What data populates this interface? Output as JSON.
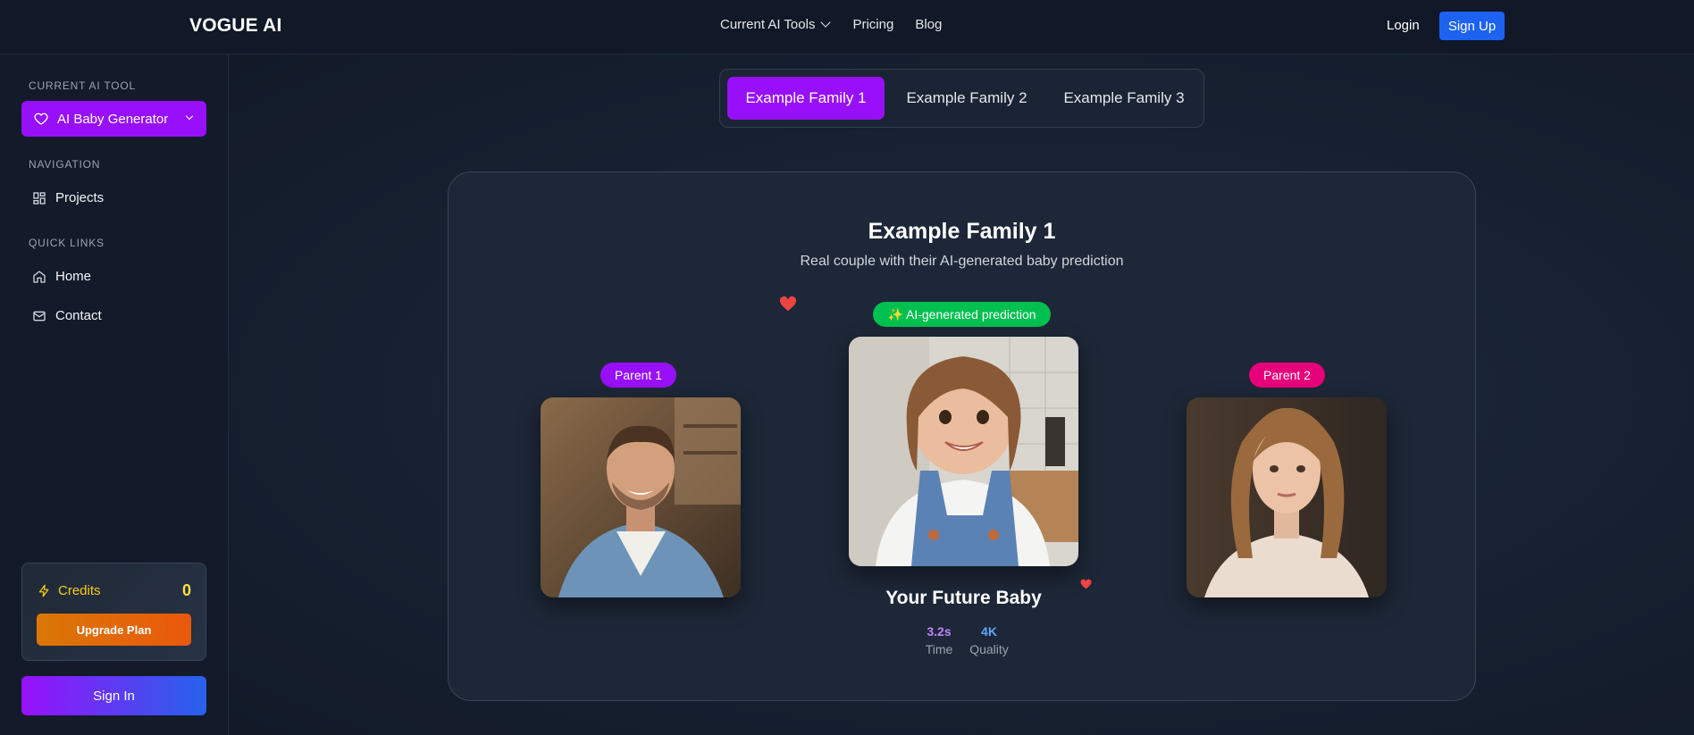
{
  "header": {
    "brand": "VOGUE AI",
    "nav": {
      "tools": "Current AI Tools",
      "pricing": "Pricing",
      "blog": "Blog"
    },
    "login": "Login",
    "signup": "Sign Up"
  },
  "sidebar": {
    "current_tool_label": "CURRENT AI TOOL",
    "current_tool": "AI Baby Generator",
    "navigation_label": "NAVIGATION",
    "projects": "Projects",
    "quick_links_label": "QUICK LINKS",
    "home": "Home",
    "contact": "Contact",
    "credits": {
      "label": "Credits",
      "value": "0",
      "upgrade": "Upgrade Plan"
    },
    "sign_in": "Sign In"
  },
  "tabs": [
    "Example Family 1",
    "Example Family 2",
    "Example Family 3"
  ],
  "active_tab": 0,
  "example": {
    "title": "Example Family 1",
    "subtitle": "Real couple with their AI-generated baby prediction",
    "parent1": "Parent 1",
    "parent2": "Parent 2",
    "ai_badge": "✨ AI-generated prediction",
    "baby_title": "Your Future Baby",
    "stats": [
      {
        "value": "3.2s",
        "label": "Time"
      },
      {
        "value": "4K",
        "label": "Quality"
      }
    ]
  },
  "colors": {
    "accent_purple": "#9810fa",
    "signup_blue": "#1d62f0",
    "ai_green": "#00c04f",
    "parent2_pink": "#e6007a",
    "credits_yellow": "#facc15"
  }
}
